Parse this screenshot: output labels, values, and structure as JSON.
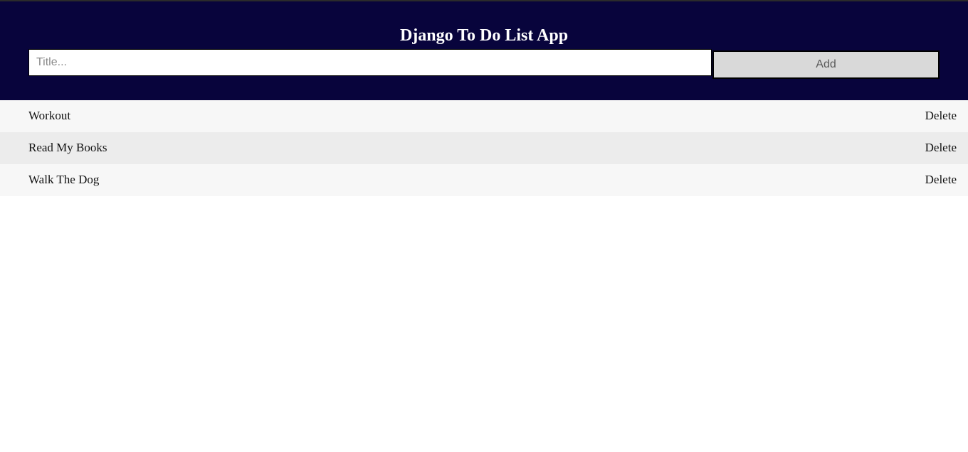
{
  "header": {
    "title": "Django To Do List App"
  },
  "form": {
    "input_placeholder": "Title...",
    "input_value": "",
    "add_label": "Add"
  },
  "tasks": [
    {
      "title": "Workout",
      "delete_label": "Delete"
    },
    {
      "title": "Read My Books",
      "delete_label": "Delete"
    },
    {
      "title": "Walk The Dog",
      "delete_label": "Delete"
    }
  ],
  "colors": {
    "header_bg": "#08043c",
    "row_odd": "#f7f7f7",
    "row_even": "#ececec",
    "button_bg": "#d9d9d9"
  }
}
